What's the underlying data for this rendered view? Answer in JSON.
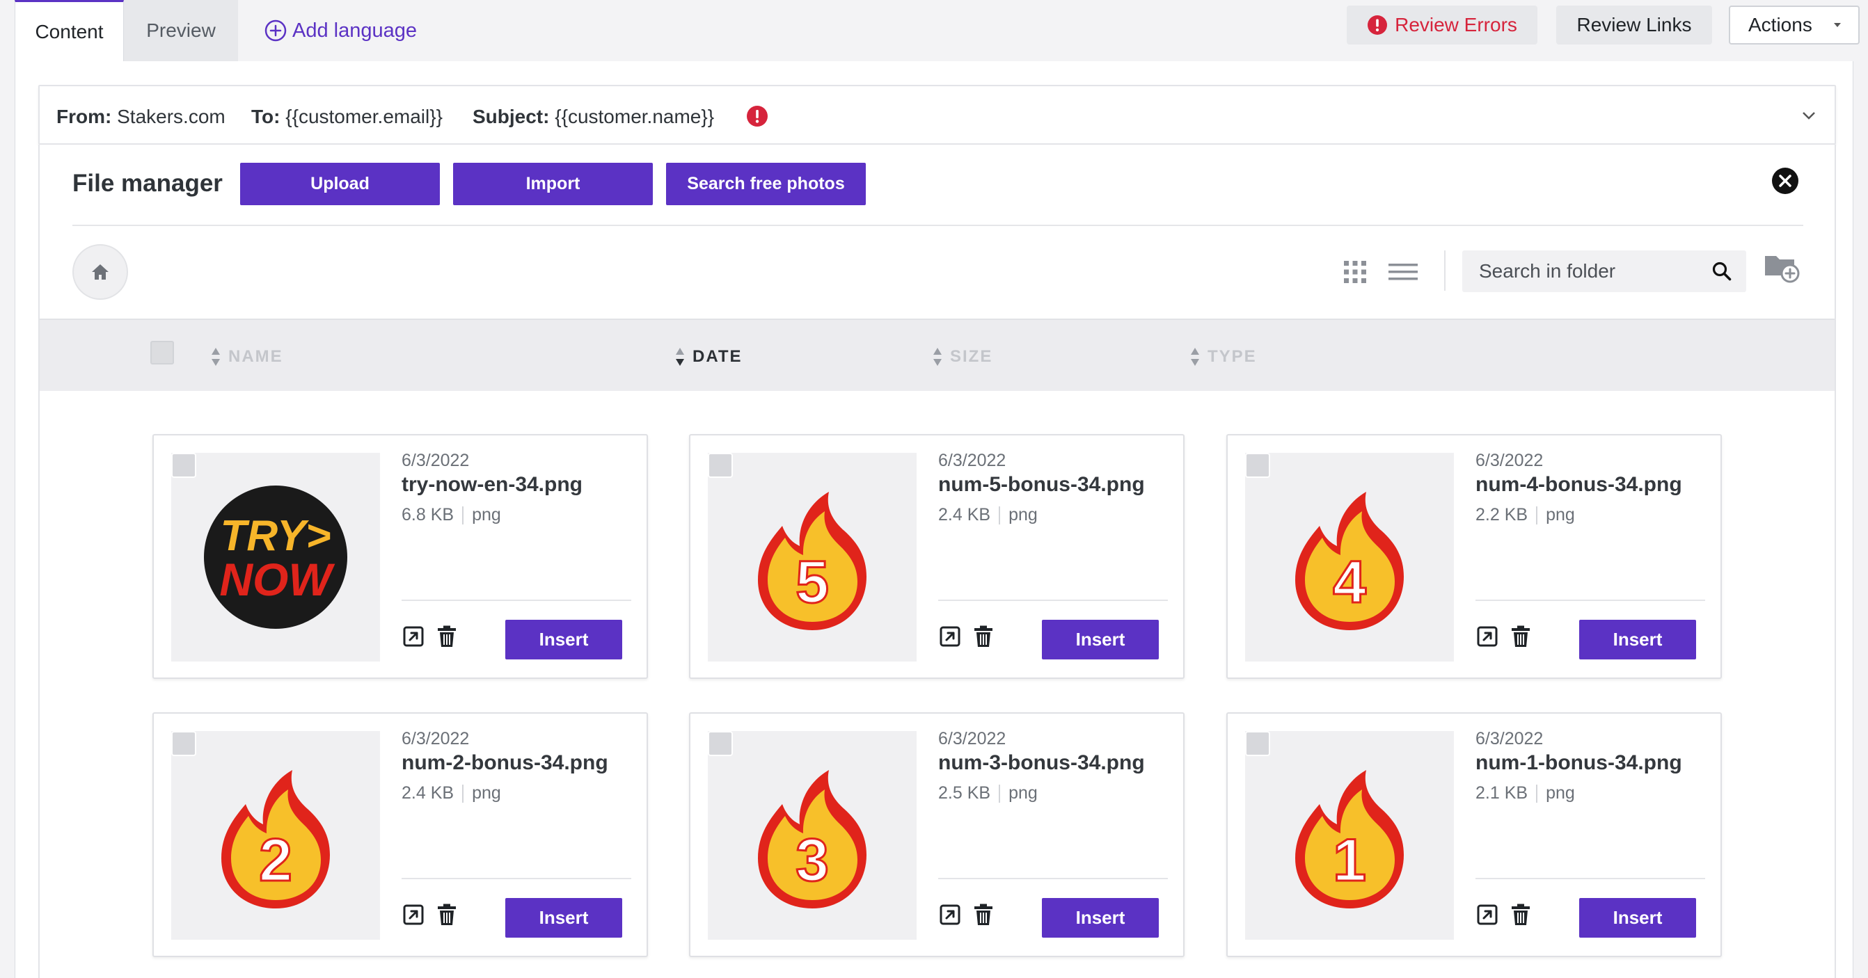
{
  "tabs": {
    "content": "Content",
    "preview": "Preview",
    "add_language": "Add language"
  },
  "toolbar": {
    "review_errors": "Review Errors",
    "review_links": "Review Links",
    "actions": "Actions"
  },
  "email_header": {
    "from_label": "From:",
    "from_value": "Stakers.com",
    "to_label": "To:",
    "to_value": "{{customer.email}}",
    "subject_label": "Subject:",
    "subject_value": "{{customer.name}}"
  },
  "file_manager": {
    "title": "File manager",
    "upload": "Upload",
    "import": "Import",
    "search_free_photos": "Search free photos",
    "search_placeholder": "Search in folder"
  },
  "columns": {
    "name": "NAME",
    "date": "DATE",
    "size": "SIZE",
    "type": "TYPE"
  },
  "files": [
    {
      "date": "6/3/2022",
      "name": "try-now-en-34.png",
      "size": "6.8 KB",
      "type": "png",
      "insert": "Insert",
      "image": "try-now-badge"
    },
    {
      "date": "6/3/2022",
      "name": "num-5-bonus-34.png",
      "size": "2.4 KB",
      "type": "png",
      "insert": "Insert",
      "image": "flame-5",
      "digit": "5"
    },
    {
      "date": "6/3/2022",
      "name": "num-4-bonus-34.png",
      "size": "2.2 KB",
      "type": "png",
      "insert": "Insert",
      "image": "flame-4",
      "digit": "4"
    },
    {
      "date": "6/3/2022",
      "name": "num-2-bonus-34.png",
      "size": "2.4 KB",
      "type": "png",
      "insert": "Insert",
      "image": "flame-2",
      "digit": "2"
    },
    {
      "date": "6/3/2022",
      "name": "num-3-bonus-34.png",
      "size": "2.5 KB",
      "type": "png",
      "insert": "Insert",
      "image": "flame-3",
      "digit": "3"
    },
    {
      "date": "6/3/2022",
      "name": "num-1-bonus-34.png",
      "size": "2.1 KB",
      "type": "png",
      "insert": "Insert",
      "image": "flame-1",
      "digit": "1"
    }
  ],
  "try_now_text": {
    "line1": "TRY>",
    "line2": "NOW"
  },
  "colors": {
    "accent": "#5b32c4",
    "error": "#d6243c",
    "flame_outer": "#e0241b",
    "flame_inner": "#f7c02a"
  }
}
